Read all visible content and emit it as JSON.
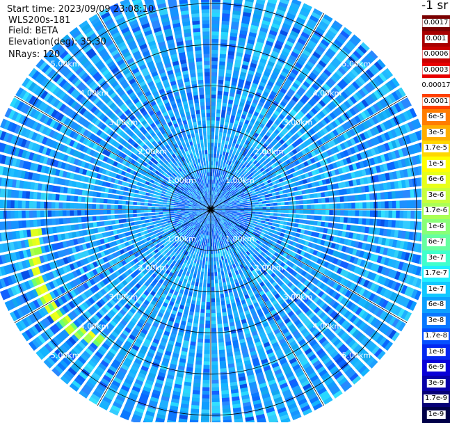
{
  "header": {
    "start_time": "Start time: 2023/09/09 23:08:10",
    "instrument": "WLS200s-181",
    "field": "Field: BETA",
    "elevation": "Elevation(deg): 35.30",
    "nrays": "NRays: 120"
  },
  "colorbar": {
    "unit_text": "-1 sr",
    "labels": [
      "0.0017",
      "0.001",
      "0.0006",
      "0.0003",
      "0.00017",
      "0.0001",
      "6e-5",
      "3e-5",
      "1.7e-5",
      "1e-5",
      "6e-6",
      "3e-6",
      "1.7e-6",
      "1e-6",
      "6e-7",
      "3e-7",
      "1.7e-7",
      "1e-7",
      "6e-8",
      "3e-8",
      "1.7e-8",
      "1e-8",
      "6e-9",
      "3e-9",
      "1.7e-9",
      "1e-9"
    ],
    "colors": [
      "#7a0000",
      "#a80000",
      "#c80000",
      "#e80000",
      "#ffffff",
      "#ff4000",
      "#ff7d00",
      "#ffae00",
      "#ffd700",
      "#ffff00",
      "#e8ff1a",
      "#c8ff3c",
      "#aaff55",
      "#88ff77",
      "#66ffa0",
      "#40ffcc",
      "#20f0ff",
      "#10c8ff",
      "#0ca0ff",
      "#0878ff",
      "#0650ff",
      "#0428f0",
      "#0a00d8",
      "#0800a8",
      "#060078",
      "#000048"
    ]
  },
  "chart_data": {
    "type": "heatmap",
    "title": "",
    "projection": "polar-ppi",
    "field": "BETA",
    "nrays": 120,
    "elevation_deg": 35.3,
    "range_rings_km": [
      1.0,
      2.0,
      3.0,
      4.0,
      5.0
    ],
    "range_ring_labels": [
      "1.00km",
      "2.00km",
      "3.00km",
      "4.00km",
      "5.00km"
    ],
    "max_range_km": 5.5,
    "azimuth_spokes_deg": [
      0,
      30,
      60,
      90,
      120,
      150,
      180,
      210,
      240,
      270,
      300,
      330
    ],
    "background_value": 1e-07,
    "features": [
      {
        "description": "high backscatter arc",
        "azimuth_deg_range": [
          220,
          265
        ],
        "range_km": [
          4.1,
          4.6
        ],
        "value_range": [
          6e-07,
          1.7e-06
        ]
      }
    ]
  }
}
